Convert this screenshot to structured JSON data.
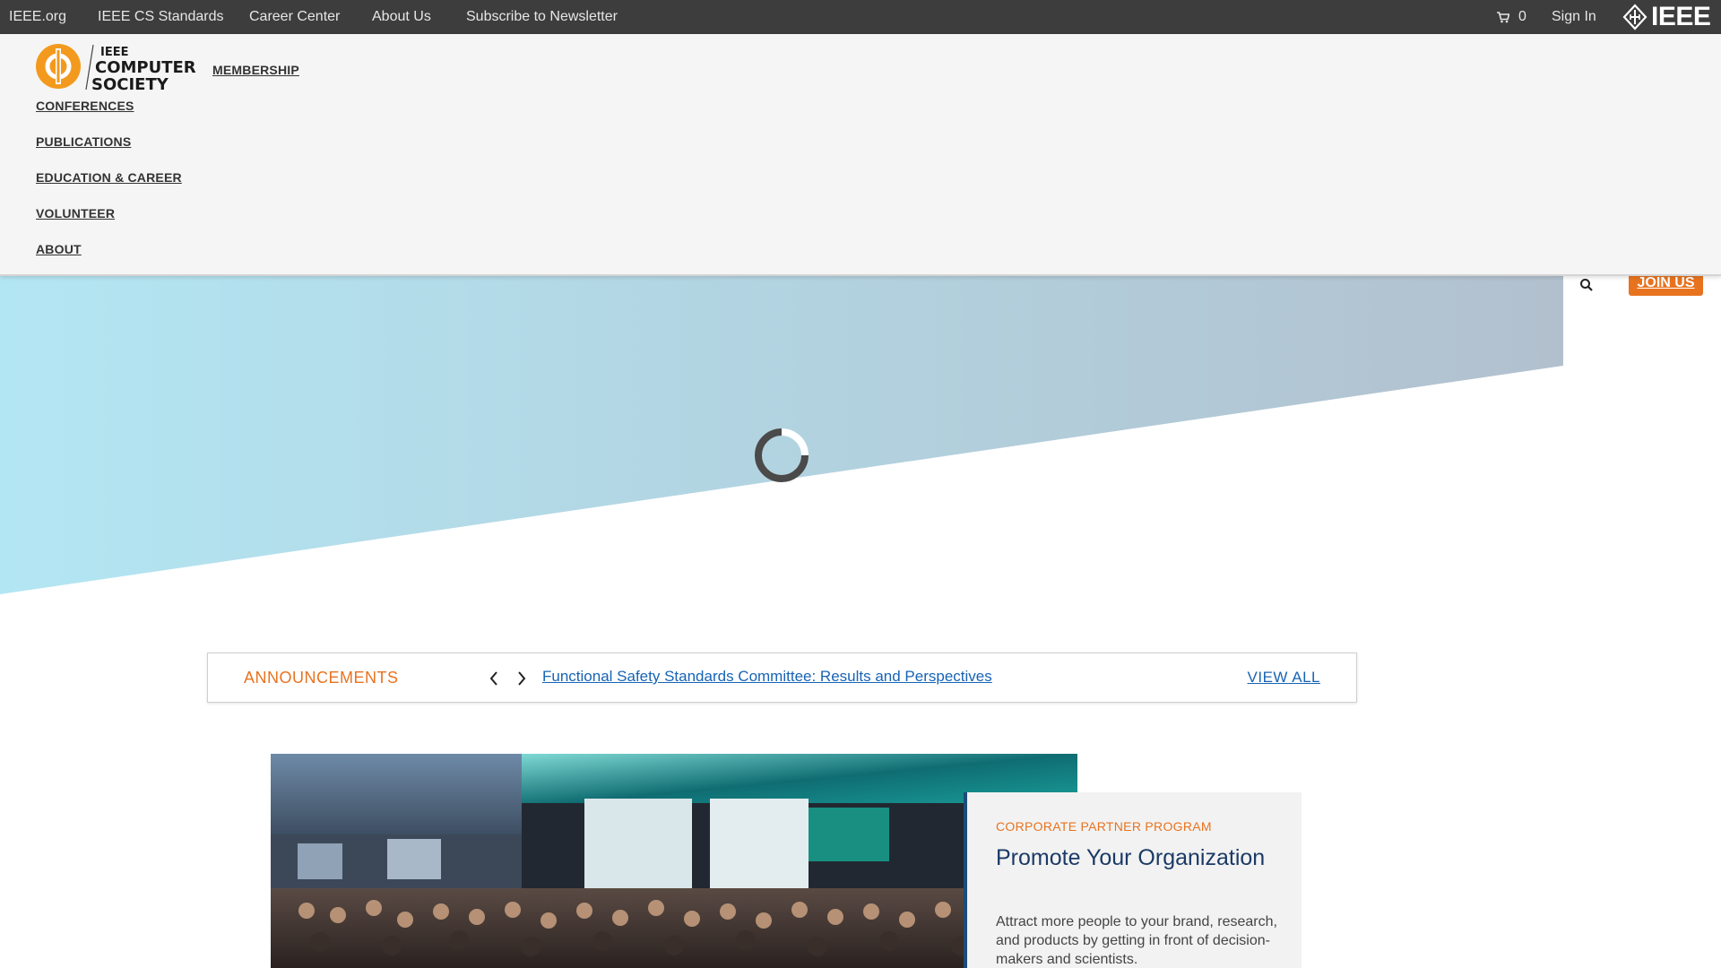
{
  "topbar": {
    "links": [
      "IEEE.org",
      "IEEE CS Standards",
      "Career Center",
      "About Us",
      "Subscribe to Newsletter"
    ],
    "cart_count": "0",
    "sign_in": "Sign In",
    "ieee_logo_text": "IEEE"
  },
  "header": {
    "logo_lines": [
      "IEEE",
      "COMPUTER",
      "SOCIETY"
    ],
    "nav": {
      "membership": "MEMBERSHIP",
      "conferences": "CONFERENCES",
      "publications": "PUBLICATIONS",
      "education_career": "EDUCATION & CAREER",
      "volunteer": "VOLUNTEER",
      "about": "ABOUT"
    },
    "join_us": "JOIN US"
  },
  "announcements": {
    "title": "ANNOUNCEMENTS",
    "headline": "Functional Safety Standards Committee: Results and Perspectives",
    "view_all": "VIEW ALL"
  },
  "promo": {
    "kicker": "CORPORATE PARTNER PROGRAM",
    "title": "Promote Your Organization",
    "description": "Attract more people to your brand, research, and products by getting in front of decision-makers and scientists."
  },
  "colors": {
    "accent_orange": "#e8731f",
    "link_blue": "#1764b5",
    "topbar_bg": "#3d3d3d",
    "header_bg": "#f5f5f5",
    "hero_gradient_start": "#b3e6f3",
    "hero_gradient_end": "#b2c0ce"
  },
  "icons": [
    "cart-icon",
    "ieee-diamond-icon",
    "search-icon",
    "chevron-left-icon",
    "chevron-right-icon",
    "loading-spinner-icon"
  ]
}
